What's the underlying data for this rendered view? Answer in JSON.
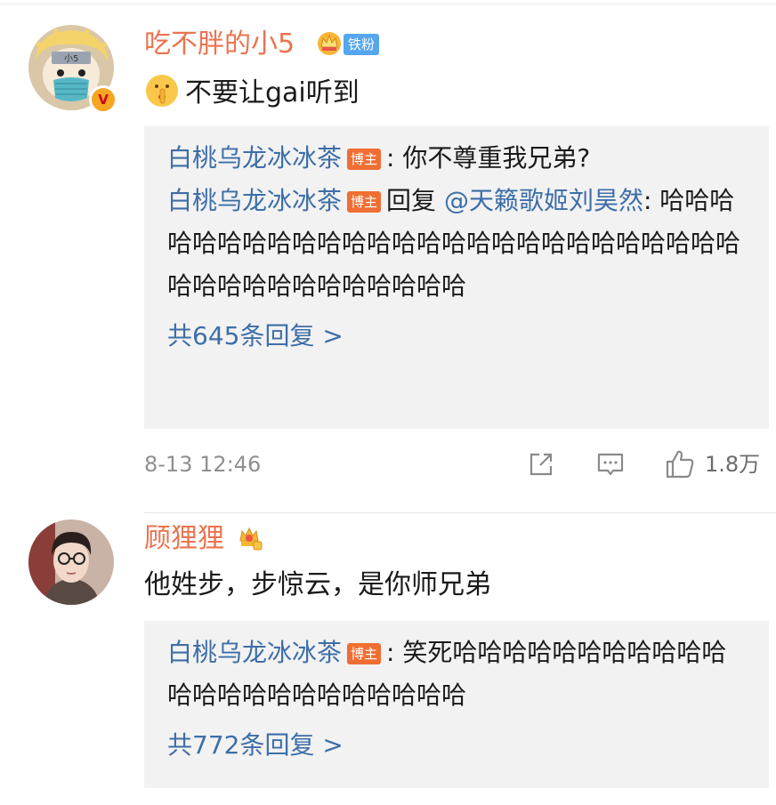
{
  "comments": [
    {
      "username": "吃不胖的小5",
      "fan_badge": "铁粉",
      "verified_mark": "V",
      "avatar_icon": "cartoon-avatar-icon",
      "emoji_icon": "shushing-face-icon",
      "text": "不要让gai听到",
      "replies": [
        {
          "name": "白桃乌龙冰冰茶",
          "badge": "博主",
          "prefix": "",
          "mention": "",
          "text": ": 你不尊重我兄弟?"
        },
        {
          "name": "白桃乌龙冰冰茶",
          "badge": "博主",
          "prefix": "回复 ",
          "mention": "@天籁歌姬刘昊然",
          "text": ": 哈哈哈哈哈哈哈哈哈哈哈哈哈哈哈哈哈哈哈哈哈哈哈哈哈哈哈哈哈哈哈哈哈哈哈哈哈哈"
        }
      ],
      "more_replies": "共645条回复 >",
      "timestamp": "8-13 12:46",
      "like_count": "1.8万"
    },
    {
      "username": "顾狸狸",
      "avatar_icon": "photo-avatar-icon",
      "text": "他姓步，步惊云，是你师兄弟",
      "replies": [
        {
          "name": "白桃乌龙冰冰茶",
          "badge": "博主",
          "text": ": 笑死哈哈哈哈哈哈哈哈哈哈哈哈哈哈哈哈哈哈哈哈哈哈哈"
        }
      ],
      "more_replies": "共772条回复 >"
    }
  ],
  "colors": {
    "username": "#eb7350",
    "link": "#3d6ea8",
    "host_badge": "#f06e33",
    "fan_badge": "#55a6ee",
    "reply_bg": "#f2f2f2",
    "meta_text": "#8f8f8f"
  }
}
